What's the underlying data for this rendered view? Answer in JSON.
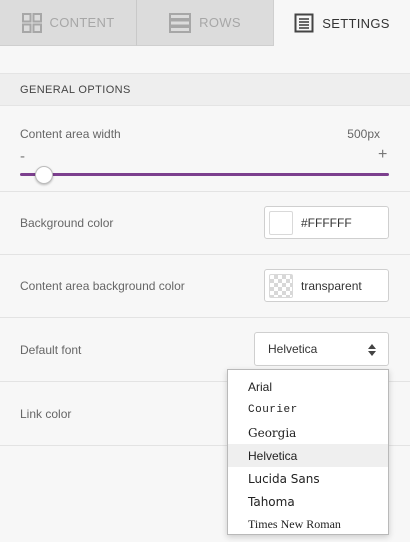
{
  "tabs": [
    {
      "label": "CONTENT",
      "icon": "grid-icon",
      "active": false
    },
    {
      "label": "ROWS",
      "icon": "rows-icon",
      "active": false
    },
    {
      "label": "SETTINGS",
      "icon": "settings-document-icon",
      "active": true
    }
  ],
  "section": {
    "title": "GENERAL OPTIONS"
  },
  "content_width": {
    "label": "Content area width",
    "value": "500px",
    "minus": "-",
    "plus": "+",
    "slider_fraction": 0.07,
    "track_color": "#7c3f8e"
  },
  "background_color": {
    "label": "Background color",
    "value": "#FFFFFF",
    "swatch": "#ffffff"
  },
  "content_background": {
    "label": "Content area background color",
    "value": "transparent"
  },
  "default_font": {
    "label": "Default font",
    "selected": "Helvetica"
  },
  "link_color": {
    "label": "Link color"
  },
  "font_options": [
    "Arial",
    "Courier",
    "Georgia",
    "Helvetica",
    "Lucida Sans",
    "Tahoma",
    "Times New Roman"
  ]
}
